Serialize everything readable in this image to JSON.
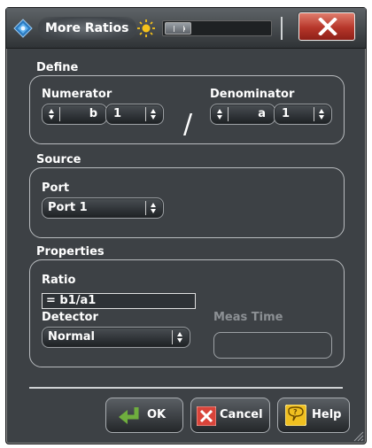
{
  "window": {
    "title": "More Ratios",
    "icons": {
      "logo": "rs-diamond-logo-icon",
      "transparency": "sun-icon",
      "close": "close-x-icon"
    }
  },
  "define": {
    "group_label": "Define",
    "numerator": {
      "label": "Numerator",
      "wave": "b",
      "port": "1"
    },
    "denominator": {
      "label": "Denominator",
      "wave": "a",
      "port": "1"
    },
    "divider": "/"
  },
  "source": {
    "group_label": "Source",
    "port_label": "Port",
    "port_value": "Port 1"
  },
  "properties": {
    "group_label": "Properties",
    "ratio_label": "Ratio",
    "ratio_value": "= b1/a1",
    "detector_label": "Detector",
    "detector_value": "Normal",
    "meas_time_label": "Meas Time",
    "meas_time_value": ""
  },
  "buttons": {
    "ok": "OK",
    "cancel": "Cancel",
    "help": "Help"
  },
  "colors": {
    "background": "#3d4145",
    "close_button": "#c0392b",
    "ok_arrow": "#6fae3e",
    "cancel_x": "#d9443a",
    "help_icon": "#f0c020"
  }
}
